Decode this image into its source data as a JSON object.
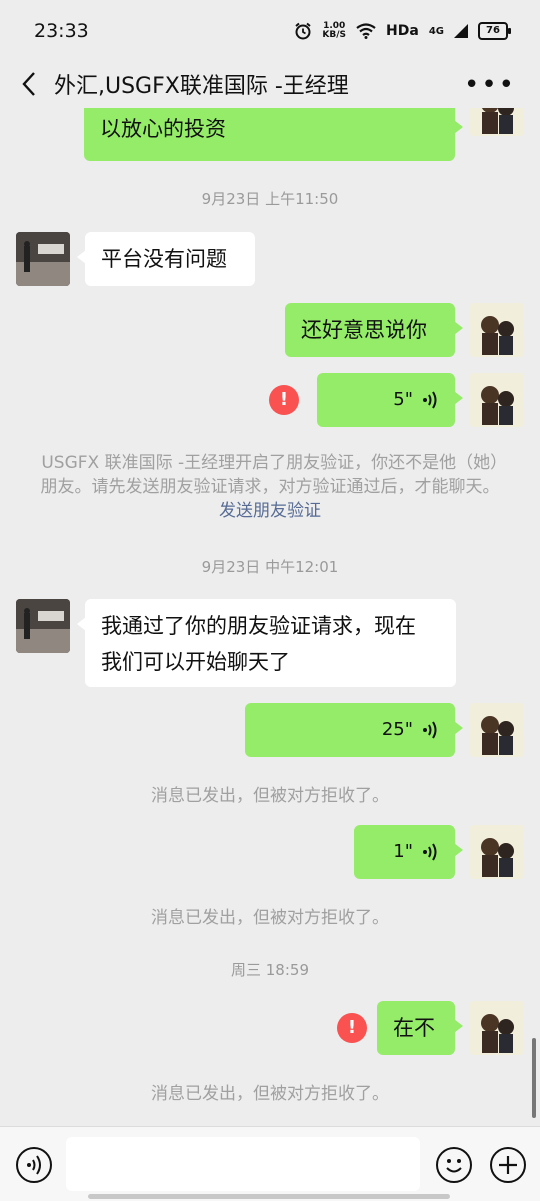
{
  "status": {
    "time": "23:33",
    "net_speed_value": "1.00",
    "net_speed_unit": "KB/S",
    "network": "HDa",
    "signal": "4G",
    "battery": "76"
  },
  "header": {
    "title": "外汇,USGFX联准国际 -王经理"
  },
  "messages": {
    "m0": "以放心的投资",
    "ts1": "9月23日 上午11:50",
    "m1": "平台没有问题",
    "m2": "还好意思说你",
    "m3_duration": "5\"",
    "m3_error": "!",
    "sys_text": "USGFX 联准国际 -王经理开启了朋友验证，你还不是他（她）朋友。请先发送朋友验证请求，对方验证通过后，才能聊天。",
    "sys_link": "发送朋友验证",
    "ts2": "9月23日 中午12:01",
    "m4_line1": "我通过了你的朋友验证请求，现在",
    "m4_line2": "我们可以开始聊天了",
    "m5_duration": "25\"",
    "rejected1": "消息已发出，但被对方拒收了。",
    "m6_duration": "1\"",
    "rejected2": "消息已发出，但被对方拒收了。",
    "ts3": "周三 18:59",
    "m7": "在不",
    "m7_error": "!",
    "rejected3": "消息已发出，但被对方拒收了。"
  },
  "input": {
    "value": "",
    "placeholder": ""
  },
  "colors": {
    "sent_bubble": "#95ec69",
    "received_bubble": "#ffffff",
    "background": "#ededed",
    "error": "#fa5151",
    "link": "#576b95"
  },
  "icons": {
    "back": "chevron-left-icon",
    "more": "more-dots-icon",
    "voice_toggle": "voice-icon",
    "emoji": "emoji-icon",
    "plus": "plus-icon"
  }
}
